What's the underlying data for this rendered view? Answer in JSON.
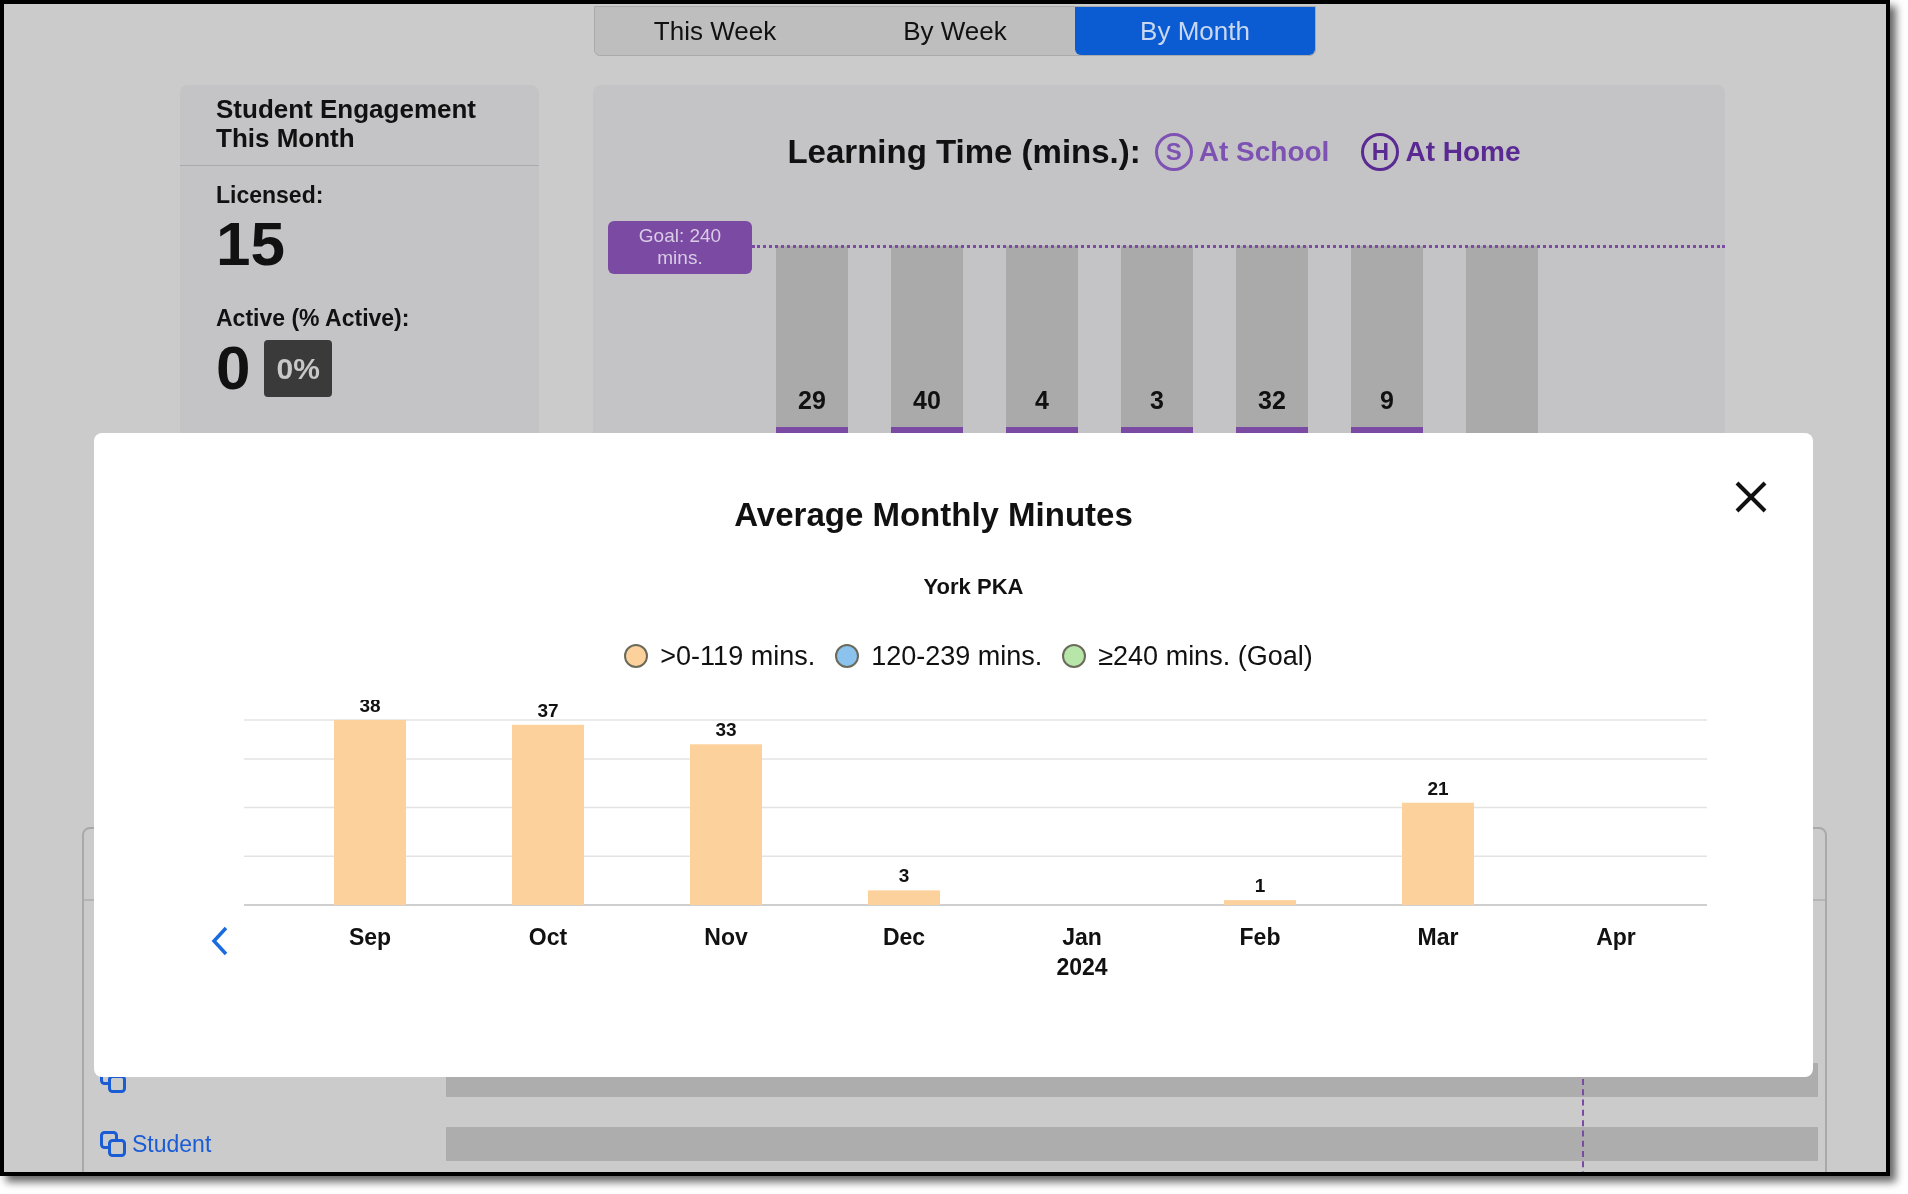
{
  "tabs": [
    {
      "label": "This Week",
      "selected": false
    },
    {
      "label": "By Week",
      "selected": false
    },
    {
      "label": "By Month",
      "selected": true
    }
  ],
  "engagement_card": {
    "title": "Student Engagement This Month",
    "licensed_label": "Licensed:",
    "licensed_value": "15",
    "active_label": "Active (% Active):",
    "active_value": "0",
    "active_percent": "0%"
  },
  "learning_time": {
    "title": "Learning Time (mins.):",
    "legend": [
      {
        "letter": "S",
        "label": "At School",
        "color": "#7d52b3"
      },
      {
        "letter": "H",
        "label": "At Home",
        "color": "#5a2a92"
      }
    ],
    "goal_label": "Goal: 240 mins.",
    "bars": [
      "29",
      "40",
      "4",
      "3",
      "32",
      "9"
    ]
  },
  "table_rows": [
    {
      "level": 0
    },
    {
      "name": "Student",
      "level": 0
    }
  ],
  "modal": {
    "title": "Average Monthly Minutes",
    "subtitle": "York PKA",
    "legend": [
      {
        "label": ">0-119 mins.",
        "color": "#fdd19b"
      },
      {
        "label": "120-239 mins.",
        "color": "#8cc3ee"
      },
      {
        "label": "≥240 mins. (Goal)",
        "color": "#b8e6a8"
      }
    ],
    "chart_data": {
      "type": "bar",
      "categories": [
        "Sep",
        "Oct",
        "Nov",
        "Dec",
        "Jan 2024",
        "Feb",
        "Mar",
        "Apr"
      ],
      "series": [
        {
          "color": "#fdd19b",
          "values": [
            38,
            37,
            33,
            3,
            null,
            1,
            21,
            null
          ]
        }
      ],
      "data_labels": true
    }
  }
}
